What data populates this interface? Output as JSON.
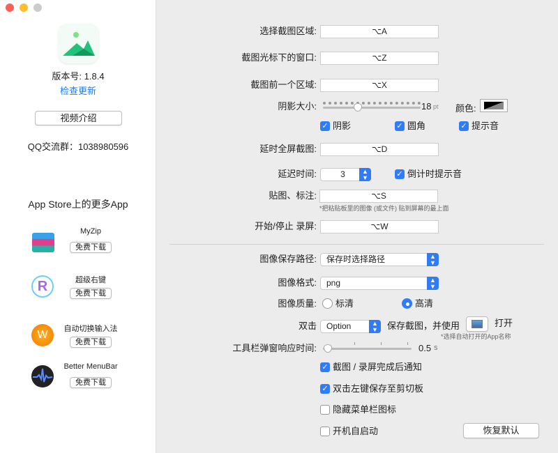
{
  "window": {
    "controls": [
      "close",
      "minimize",
      "zoom"
    ]
  },
  "sidebar": {
    "version": "版本号: 1.8.4",
    "check_update": "检查更新",
    "video_button": "视频介绍",
    "qq_group": "QQ交流群：1038980596",
    "more_apps_title": "App Store上的更多App",
    "apps": [
      {
        "name": "MyZip",
        "button": "免费下载",
        "icon": "archive-books-icon"
      },
      {
        "name": "超级右键",
        "button": "免费下载",
        "icon": "r-letter-icon"
      },
      {
        "name": "自动切换输入法",
        "button": "免费下载",
        "icon": "input-switch-icon"
      },
      {
        "name": "Better MenuBar",
        "button": "免费下载",
        "icon": "waveform-icon"
      }
    ]
  },
  "settings": {
    "select_area": {
      "label": "选择截图区域:",
      "value": "⌥A"
    },
    "window_under_cursor": {
      "label": "截图光标下的窗口:",
      "value": "⌥Z"
    },
    "previous_area": {
      "label": "截图前一个区域:",
      "value": "⌥X"
    },
    "shadow_size": {
      "label": "阴影大小:",
      "value": "18",
      "unit": "pt",
      "color_label": "颜色:"
    },
    "toggles": [
      {
        "label": "阴影",
        "checked": true
      },
      {
        "label": "圆角",
        "checked": true
      },
      {
        "label": "提示音",
        "checked": true
      }
    ],
    "delayed_fullscreen": {
      "label": "延时全屏截图:",
      "value": "⌥D"
    },
    "delay_time": {
      "label": "延迟时间:",
      "value": "3",
      "countdown_label": "倒计时提示音",
      "countdown_checked": true
    },
    "pin": {
      "label": "贴图、标注:",
      "value": "⌥S",
      "note": "*把粘贴板里的图像 (或文件) 贴到屏幕的最上面"
    },
    "record": {
      "label": "开始/停止 录屏:",
      "value": "⌥W"
    },
    "save_path": {
      "label": "图像保存路径:",
      "value": "保存时选择路径"
    },
    "format": {
      "label": "图像格式:",
      "value": "png"
    },
    "quality": {
      "label": "图像质量:",
      "options": [
        "标清",
        "高清"
      ],
      "selected": "高清"
    },
    "double_click": {
      "label": "双击",
      "value": "Option",
      "text": "保存截图，并使用",
      "open": "打开",
      "note": "*选择自动打开的App名称"
    },
    "toolbar_delay": {
      "label": "工具栏弹窗响应时间:",
      "value": "0.5",
      "unit": "s"
    },
    "options": [
      {
        "label": "截图 / 录屏完成后通知",
        "checked": true
      },
      {
        "label": "双击左键保存至剪切板",
        "checked": true
      },
      {
        "label": "隐藏菜单栏图标",
        "checked": false
      },
      {
        "label": "开机自启动",
        "checked": false
      }
    ],
    "reset_button": "恢复默认"
  },
  "colors": {
    "accent": "#2f7cf6",
    "link": "#1a7cf5"
  }
}
